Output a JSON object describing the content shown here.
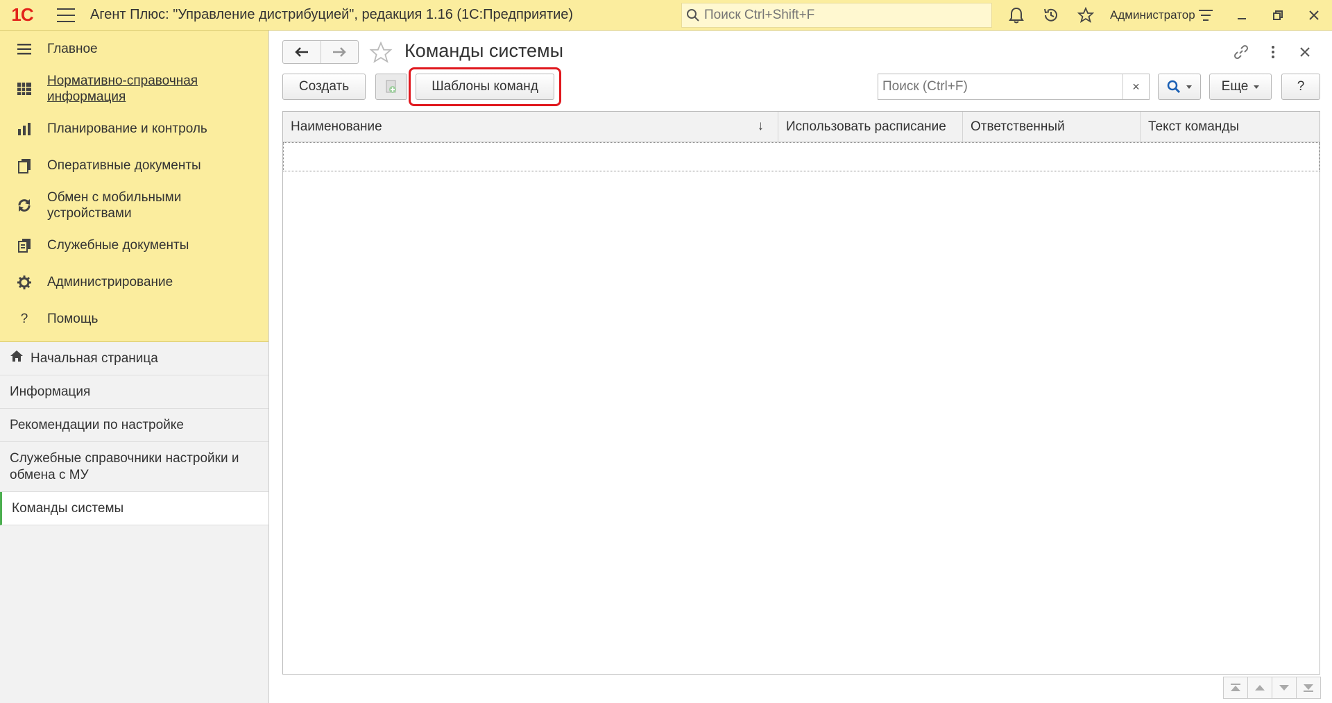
{
  "app": {
    "logo_text": "1С",
    "title": "Агент Плюс: \"Управление дистрибуцией\", редакция 1.16  (1С:Предприятие)",
    "search_placeholder": "Поиск Ctrl+Shift+F",
    "user": "Администратор"
  },
  "sections": [
    {
      "label": "Главное",
      "icon": "menu-lines-icon"
    },
    {
      "label": "Нормативно-справочная информация",
      "icon": "directory-icon"
    },
    {
      "label": "Планирование и контроль",
      "icon": "chart-icon"
    },
    {
      "label": "Оперативные документы",
      "icon": "documents-icon"
    },
    {
      "label": "Обмен с мобильными устройствами",
      "icon": "sync-icon"
    },
    {
      "label": "Служебные документы",
      "icon": "service-documents-icon"
    },
    {
      "label": "Администрирование",
      "icon": "gear-icon"
    },
    {
      "label": "Помощь",
      "icon": "question-icon"
    }
  ],
  "nav": {
    "home": "Начальная страница",
    "items": [
      "Информация",
      "Рекомендации по настройке",
      "Служебные справочники настройки и обмена с МУ",
      "Команды системы"
    ]
  },
  "page": {
    "title": "Команды системы"
  },
  "toolbar": {
    "create": "Создать",
    "templates": "Шаблоны команд",
    "search_placeholder": "Поиск (Ctrl+F)",
    "clear": "×",
    "more": "Еще",
    "help": "?"
  },
  "grid": {
    "columns": [
      "Наименование",
      "Использовать расписание",
      "Ответственный",
      "Текст команды"
    ],
    "sort_indicator": "↓"
  },
  "colors": {
    "accent_yellow": "#fbed9e",
    "highlight_red": "#e0181e",
    "current_marker": "#4caf50"
  }
}
